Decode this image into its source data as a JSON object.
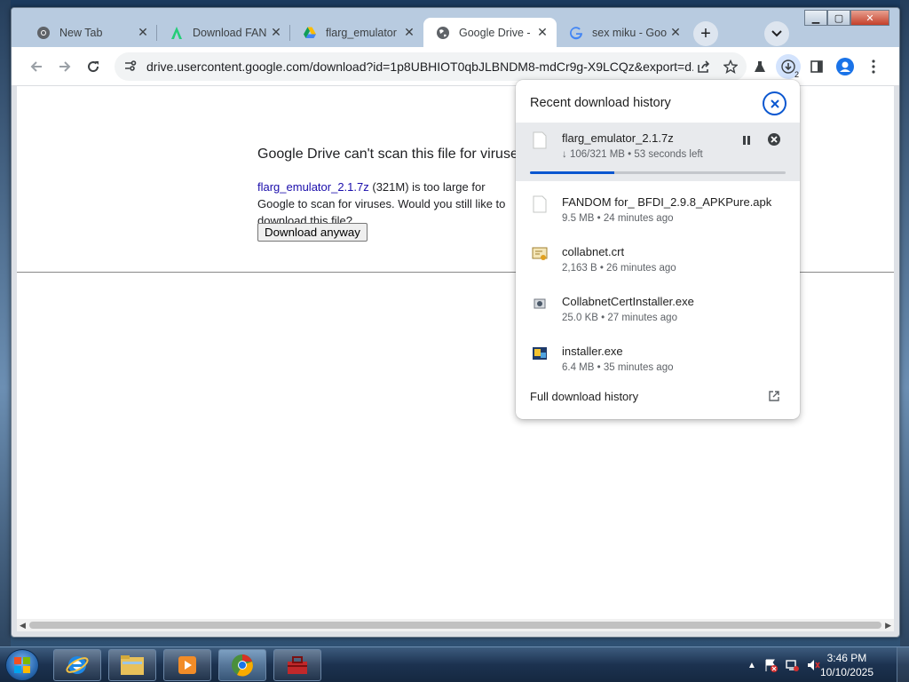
{
  "window": {
    "controls": {
      "minimize": "▁",
      "maximize": "▢",
      "close": "✕"
    }
  },
  "tabs": [
    {
      "title": "New Tab",
      "icon": "chrome-icon",
      "active": false
    },
    {
      "title": "Download FAN",
      "icon": "apkpure-icon",
      "active": false
    },
    {
      "title": "flarg_emulator",
      "icon": "google-drive-icon",
      "active": false
    },
    {
      "title": "Google Drive -",
      "icon": "globe-icon",
      "active": true
    },
    {
      "title": "sex miku - Goo",
      "icon": "google-icon",
      "active": false
    }
  ],
  "toolbar": {
    "url": "drive.usercontent.google.com/download?id=1p8UBHIOT0qbJLBNDM8-mdCr9g-X9LCQz&export=d...",
    "download_badge": "2"
  },
  "page": {
    "title": "Google Drive can't scan this file for viruses.",
    "file_link": "flarg_emulator_2.1.7z",
    "body_rest": " (321M) is too large for Google to scan for viruses. Would you still like to download this file?",
    "button": "Download anyway"
  },
  "download_bubble": {
    "header": "Recent download history",
    "items": [
      {
        "name": "flarg_emulator_2.1.7z",
        "meta": "↓ 106/321 MB • 53 seconds left",
        "progress": 0.33,
        "icon": "file-icon",
        "active": true
      },
      {
        "name": "FANDOM for_ BFDI_2.9.8_APKPure.apk",
        "meta": "9.5 MB • 24 minutes ago",
        "icon": "file-icon"
      },
      {
        "name": "collabnet.crt",
        "meta": "2,163 B • 26 minutes ago",
        "icon": "certificate-icon"
      },
      {
        "name": "CollabnetCertInstaller.exe",
        "meta": "25.0 KB • 27 minutes ago",
        "icon": "exe-icon"
      },
      {
        "name": "installer.exe",
        "meta": "6.4 MB • 35 minutes ago",
        "icon": "installer-icon"
      }
    ],
    "footer": "Full download history"
  },
  "taskbar": {
    "time": "3:46 PM",
    "date": "10/10/2025"
  },
  "colors": {
    "accent": "#0b57d0",
    "link": "#1a0dab"
  }
}
